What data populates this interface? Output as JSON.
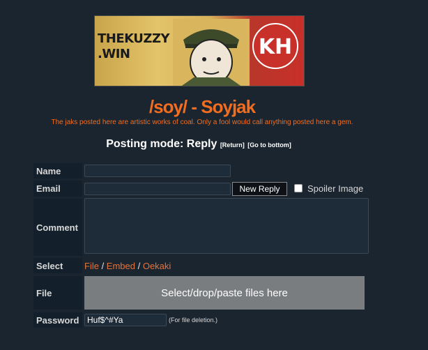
{
  "banner": {
    "text_line1": "THEKUZZY",
    "text_line2": ".WIN",
    "logo_text": "KH"
  },
  "board": {
    "title": "/soy/ - Soyjak",
    "subtitle": "The jaks posted here are artistic works of coal. Only a fool would call anything posted here a gem."
  },
  "posting": {
    "mode": "Posting mode: Reply",
    "return_link": "[Return]",
    "bottom_link": "[Go to bottom]"
  },
  "form": {
    "name_label": "Name",
    "email_label": "Email",
    "comment_label": "Comment",
    "select_label": "Select",
    "file_label": "File",
    "password_label": "Password",
    "submit": "New Reply",
    "spoiler": "Spoiler Image",
    "select_links": [
      "File",
      "Embed",
      "Oekaki"
    ],
    "dropzone": "Select/drop/paste files here",
    "password_value": "Huf$^#Ya",
    "password_note": "(For file deletion.)"
  },
  "colors": {
    "accent": "#f26d1f",
    "background": "#1b2530",
    "link": "#e2733a"
  }
}
